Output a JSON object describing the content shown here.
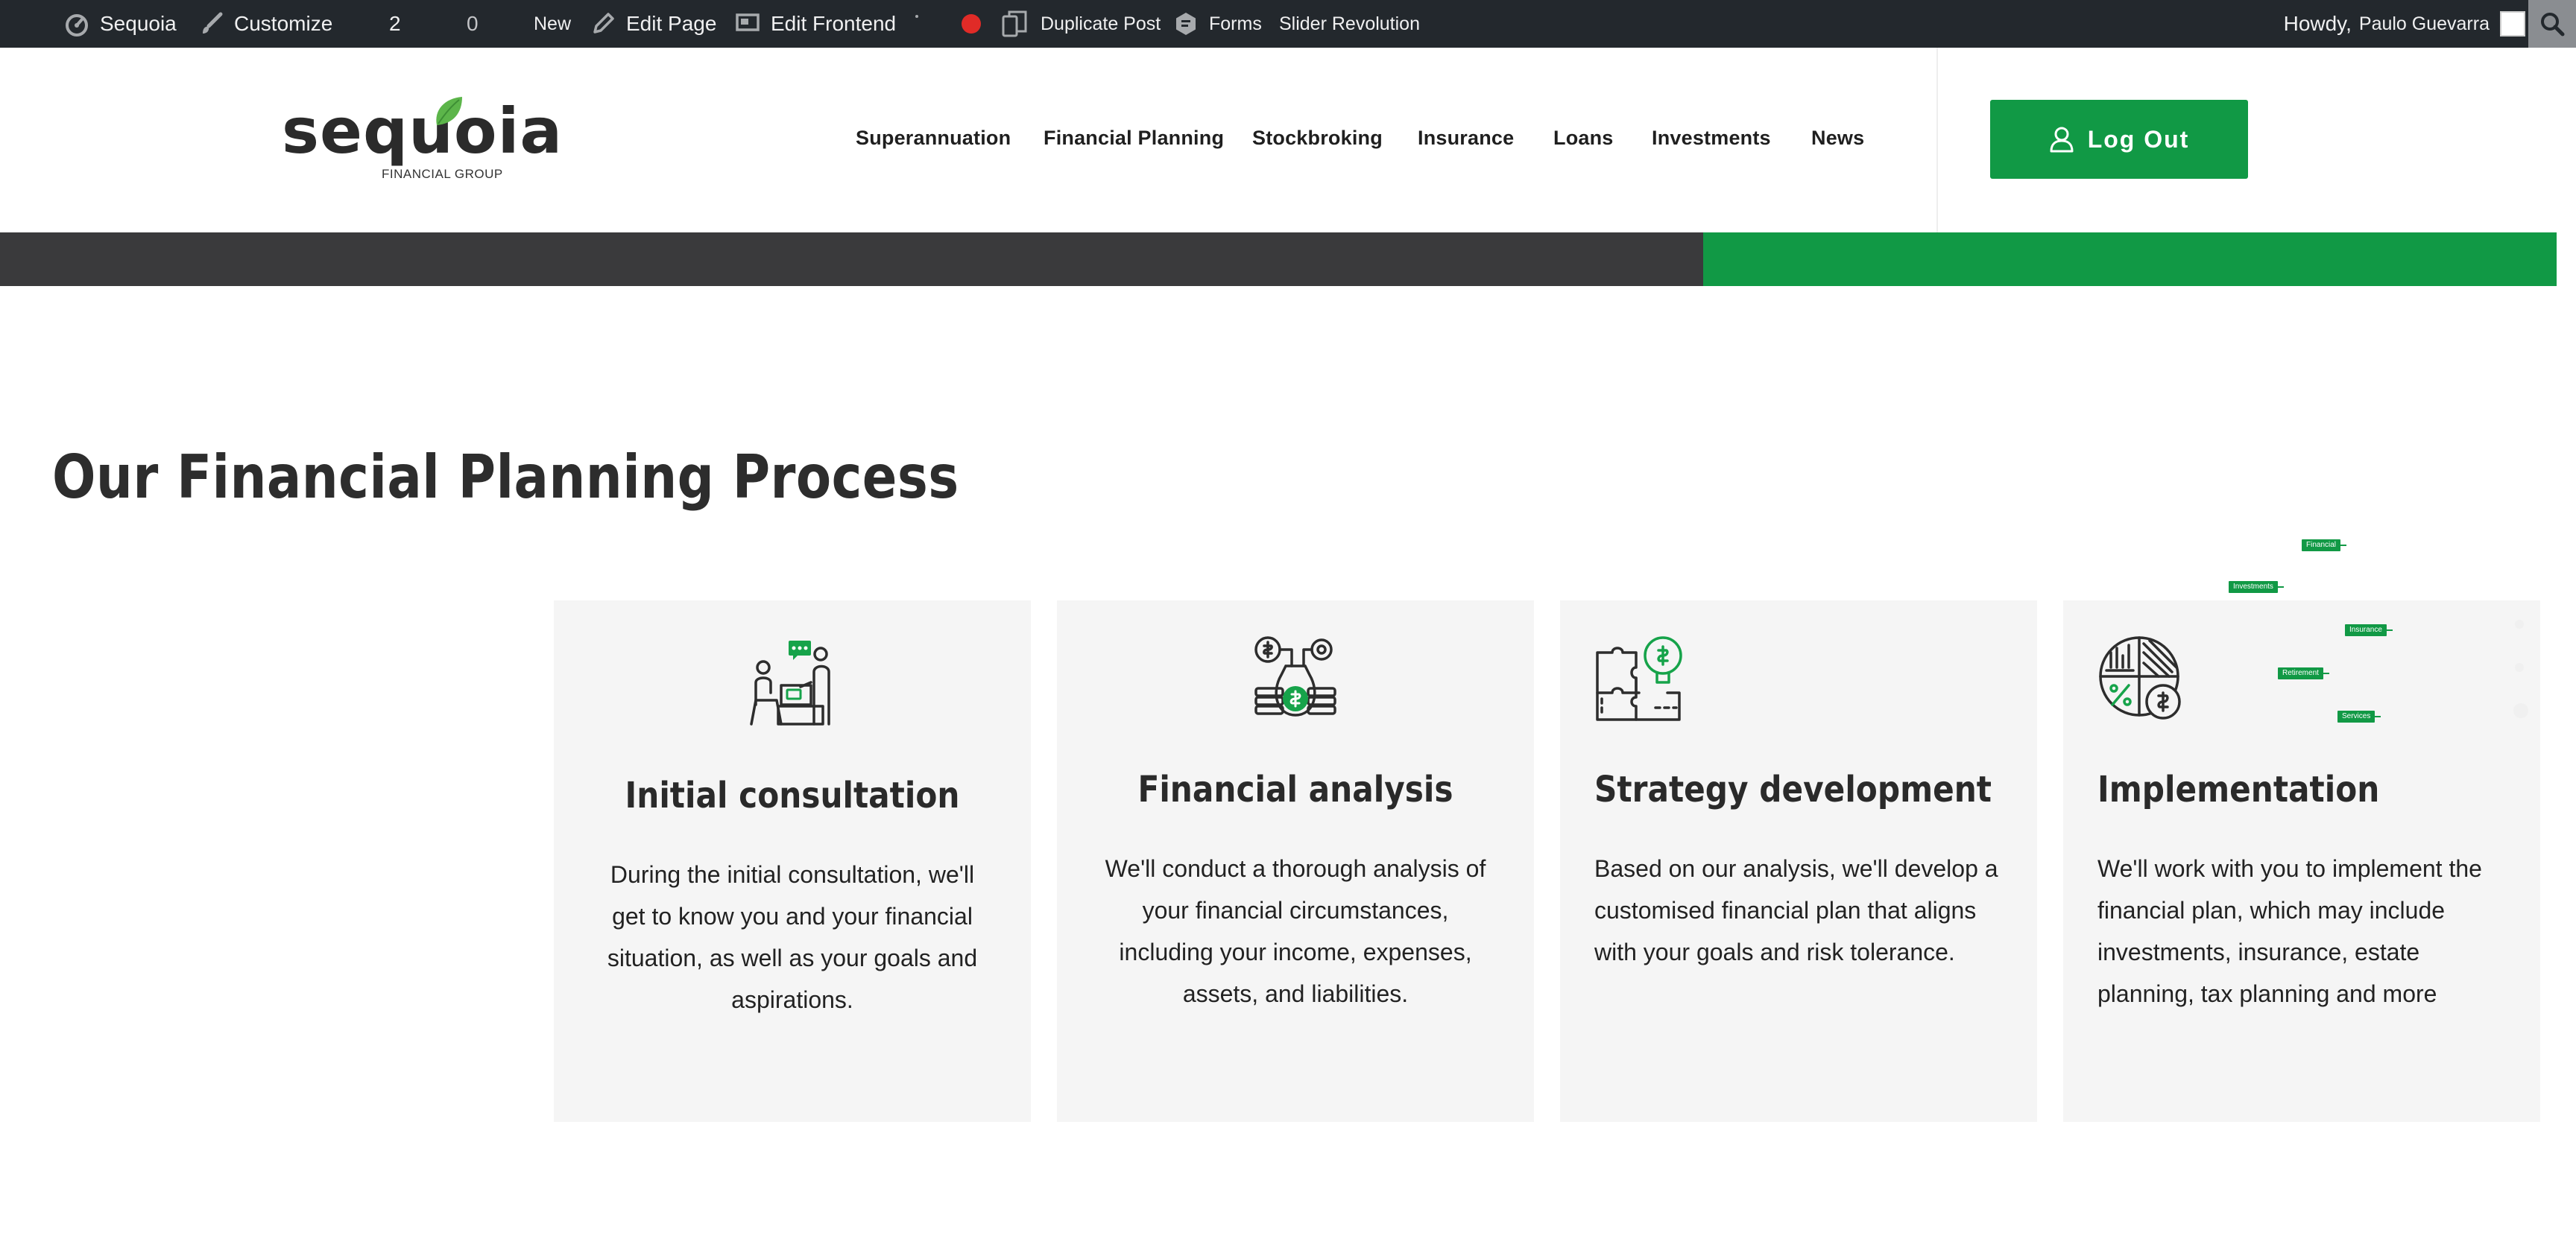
{
  "admin_bar": {
    "site_name": "Sequoia",
    "customize": "Customize",
    "updates_count": "2",
    "comments_count": "0",
    "new": "New",
    "edit_page": "Edit Page",
    "edit_frontend": "Edit Frontend",
    "duplicate_post": "Duplicate Post",
    "forms": "Forms",
    "slider_revolution": "Slider Revolution",
    "howdy": "Howdy,",
    "user_name": "Paulo Guevarra"
  },
  "header": {
    "logo_word": "sequoia",
    "logo_sub": "FINANCIAL GROUP",
    "nav": [
      "Superannuation",
      "Financial Planning",
      "Stockbroking",
      "Insurance",
      "Loans",
      "Investments",
      "News"
    ],
    "logout_label": "Log Out"
  },
  "section": {
    "title": "Our Financial Planning Process",
    "cards": [
      {
        "icon": "consultation-icon",
        "title": "Initial consultation",
        "body": "During the initial consultation, we'll get to know you and your financial situation, as well as your goals and aspirations."
      },
      {
        "icon": "financial-analysis-icon",
        "title": "Financial analysis",
        "body": "We'll conduct a thorough analysis of your financial circumstances, including your income, expenses, assets, and liabilities."
      },
      {
        "icon": "strategy-icon",
        "title": "Strategy development",
        "body": "Based on our analysis, we'll develop a customised financial plan that aligns with your goals and risk tolerance."
      },
      {
        "icon": "implementation-icon",
        "title": "Implementation",
        "body": "We'll work with you to implement the financial plan, which may include investments, insurance, estate planning, tax planning and more"
      }
    ]
  },
  "floating_tags": [
    "Financial",
    "Investments",
    "Insurance",
    "Retirement",
    "Services"
  ],
  "colors": {
    "brand_green": "#119945",
    "admin_bar": "#23282d",
    "stripe_dark": "#3a3a3c",
    "card_bg": "#f5f5f5"
  }
}
